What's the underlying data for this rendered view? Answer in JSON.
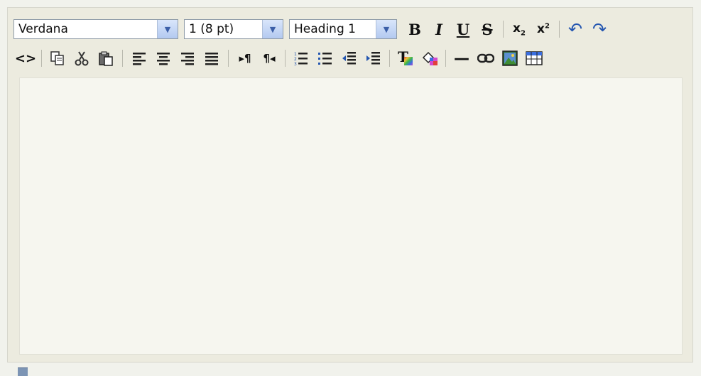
{
  "toolbar": {
    "font_family": "Verdana",
    "font_size": "1 (8 pt)",
    "paragraph_format": "Heading 1",
    "bold_label": "B",
    "italic_label": "I",
    "underline_label": "U",
    "strike_label": "S",
    "subscript_label": "x",
    "subscript_mark": "2",
    "superscript_label": "x",
    "superscript_mark": "2",
    "undo_label": "↶",
    "redo_label": "↷",
    "html_source_label": "<>",
    "ltr_label": "▸¶",
    "rtl_label": "¶◂",
    "text_color_label": "T",
    "hr_label": "—"
  },
  "icons": [
    "html-source-icon",
    "copy-icon",
    "cut-icon",
    "paste-icon",
    "align-left-icon",
    "align-center-icon",
    "align-right-icon",
    "justify-icon",
    "ltr-icon",
    "rtl-icon",
    "ordered-list-icon",
    "unordered-list-icon",
    "outdent-icon",
    "indent-icon",
    "text-color-icon",
    "background-color-icon",
    "horizontal-rule-icon",
    "link-icon",
    "image-icon",
    "table-icon"
  ]
}
